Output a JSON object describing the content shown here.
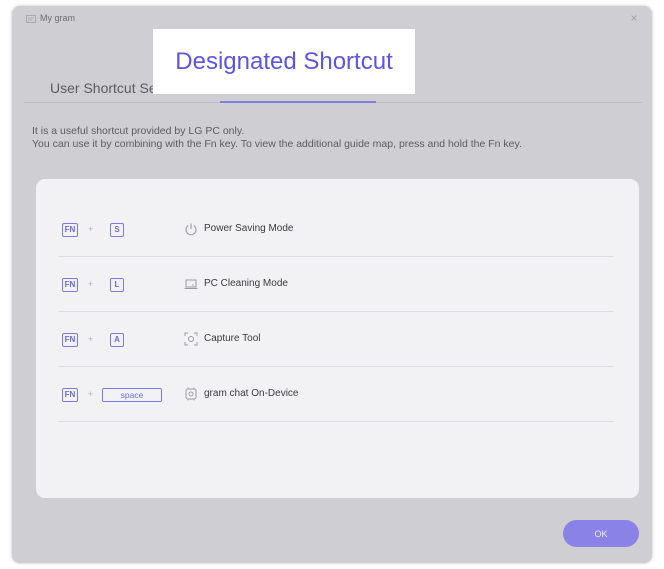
{
  "window": {
    "title": "My gram",
    "close_glyph": "×"
  },
  "tabs": {
    "user_shortcut": "User Shortcut Set",
    "designated_shortcut": "Designated Shortcut"
  },
  "description": {
    "line1": "It is a useful shortcut provided by LG PC only.",
    "line2": "You can use it by combining with the Fn key. To view the additional guide map, press and hold the Fn key."
  },
  "shortcuts": [
    {
      "modifier": "FN",
      "separator": "+",
      "key": "S",
      "icon": "power-icon",
      "label": "Power Saving Mode"
    },
    {
      "modifier": "FN",
      "separator": "+",
      "key": "L",
      "icon": "laptop-icon",
      "label": "PC Cleaning Mode"
    },
    {
      "modifier": "FN",
      "separator": "+",
      "key": "A",
      "icon": "capture-icon",
      "label": "Capture Tool"
    },
    {
      "modifier": "FN",
      "separator": "+",
      "key": "space",
      "icon": "chat-icon",
      "label": "gram chat On-Device"
    }
  ],
  "footer": {
    "ok_label": "OK"
  },
  "colors": {
    "accent": "#5b55e8",
    "key_outline": "#7a7ae6",
    "ok_button": "#8a82e6",
    "window_bg": "#cfcfd3",
    "card_bg": "#f2f2f5"
  }
}
